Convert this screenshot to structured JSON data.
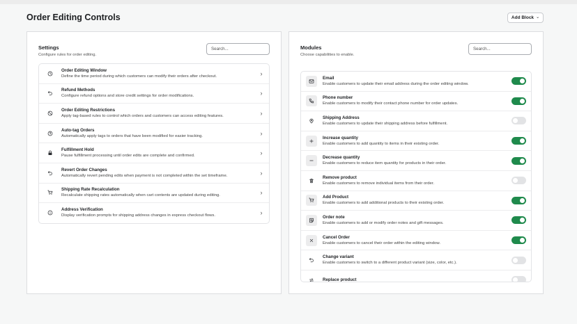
{
  "page": {
    "title": "Order Editing Controls",
    "add_block_label": "Add Block"
  },
  "settings": {
    "title": "Settings",
    "subtitle": "Configure rules for order editing.",
    "search_placeholder": "Search...",
    "items": [
      {
        "icon": "clock-icon",
        "title": "Order Editing Window",
        "desc": "Define the time period during which customers can modify their orders after checkout."
      },
      {
        "icon": "undo-icon",
        "title": "Refund Methods",
        "desc": "Configure refund options and store credit settings for order modifications."
      },
      {
        "icon": "ban-icon",
        "title": "Order Editing Restrictions",
        "desc": "Apply tag-based rules to control which orders and customers can access editing features."
      },
      {
        "icon": "help-circle-icon",
        "title": "Auto-tag Orders",
        "desc": "Automatically apply tags to orders that have been modified for easier tracking."
      },
      {
        "icon": "lock-icon",
        "title": "Fulfillment Hold",
        "desc": "Pause fulfillment processing until order edits are complete and confirmed."
      },
      {
        "icon": "undo-icon",
        "title": "Revert Order Changes",
        "desc": "Automatically revert pending edits when payment is not completed within the set timeframe."
      },
      {
        "icon": "cart-icon",
        "title": "Shipping Rate Recalculation",
        "desc": "Recalculate shipping rates automatically when cart contents are updated during editing."
      },
      {
        "icon": "info-icon",
        "title": "Address Verification",
        "desc": "Display verification prompts for shipping address changes in express checkout flows."
      }
    ]
  },
  "modules": {
    "title": "Modules",
    "subtitle": "Choose capabilities to enable.",
    "search_placeholder": "Search...",
    "items": [
      {
        "icon": "email-icon",
        "title": "Email",
        "desc": "Enable customers to update their email address during the order editing window.",
        "enabled": true,
        "boxed": true
      },
      {
        "icon": "phone-icon",
        "title": "Phone number",
        "desc": "Enable customers to modify their contact phone number for order updates.",
        "enabled": true,
        "boxed": true
      },
      {
        "icon": "location-pin-icon",
        "title": "Shipping Address",
        "desc": "Enable customers to update their shipping address before fulfillment.",
        "enabled": false,
        "boxed": false
      },
      {
        "icon": "plus-icon",
        "title": "Increase quantity",
        "desc": "Enable customers to add quantity to items in their existing order.",
        "enabled": true,
        "boxed": true
      },
      {
        "icon": "minus-icon",
        "title": "Decrease quantity",
        "desc": "Enable customers to reduce item quantity for products in their order.",
        "enabled": true,
        "boxed": true
      },
      {
        "icon": "trash-icon",
        "title": "Remove product",
        "desc": "Enable customers to remove individual items from their order.",
        "enabled": false,
        "boxed": false
      },
      {
        "icon": "cart-icon",
        "title": "Add Product",
        "desc": "Enable customers to add additional products to their existing order.",
        "enabled": true,
        "boxed": true
      },
      {
        "icon": "note-icon",
        "title": "Order note",
        "desc": "Enable customers to add or modify order notes and gift messages.",
        "enabled": true,
        "boxed": true
      },
      {
        "icon": "close-icon",
        "title": "Cancel Order",
        "desc": "Enable customers to cancel their order within the editing window.",
        "enabled": true,
        "boxed": true
      },
      {
        "icon": "undo-icon",
        "title": "Change variant",
        "desc": "Enable customers to switch to a different product variant (size, color, etc.).",
        "enabled": false,
        "boxed": false
      },
      {
        "icon": "replace-icon",
        "title": "Replace product",
        "desc": "",
        "enabled": false,
        "boxed": false
      }
    ]
  }
}
